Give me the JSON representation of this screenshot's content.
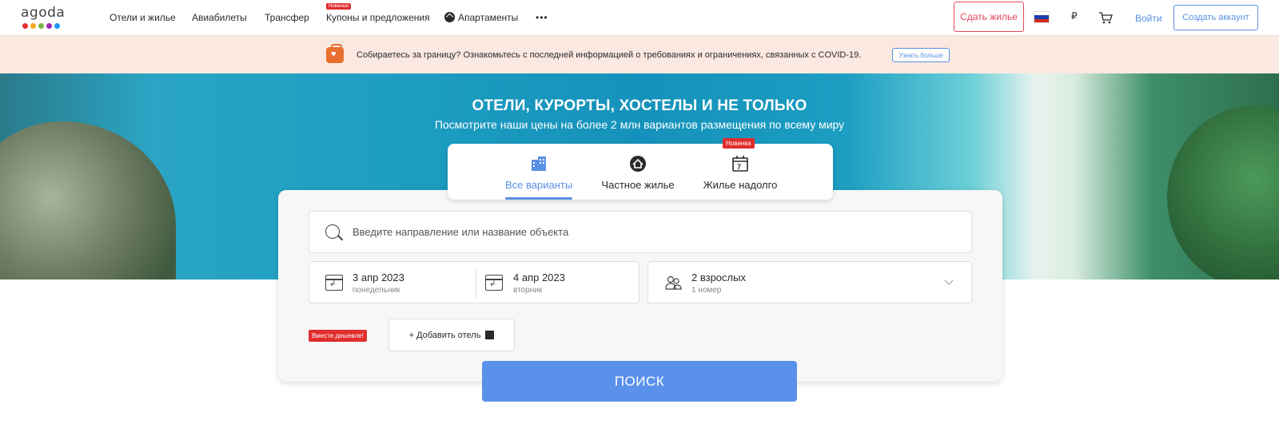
{
  "logo": {
    "text": "agoda",
    "dot_colors": [
      "#e12d2d",
      "#f5a623",
      "#7cb342",
      "#9c27b0",
      "#2196f3"
    ]
  },
  "nav": {
    "items": [
      "Отели и жилье",
      "Авиабилеты",
      "Трансфер",
      "Купоны и предложения",
      "Апартаменты",
      "•••"
    ],
    "coupons_badge": "Новинка!",
    "host_button": "Сдать жилье",
    "currency": "₽",
    "login": "Войти",
    "create_account": "Создать аккаунт"
  },
  "covid": {
    "text": "Собираетесь за границу? Ознакомьтесь с последней информацией о требованиях и ограничениях, связанных с COVID-19.",
    "button": "Узнать больше"
  },
  "hero": {
    "title": "ОТЕЛИ, КУРОРТЫ, ХОСТЕЛЫ И НЕ ТОЛЬКО",
    "subtitle": "Посмотрите наши цены на более 2 млн вариантов размещения по всему миру"
  },
  "tabs": {
    "items": [
      "Все варианты",
      "Частное жилье",
      "Жилье надолго"
    ],
    "active": "Все варианты",
    "new_badge": "Новинка"
  },
  "search": {
    "placeholder": "Введите направление или название объекта",
    "checkin": {
      "date": "3 апр 2023",
      "weekday": "понедельник"
    },
    "checkout": {
      "date": "4 апр 2023",
      "weekday": "вторник"
    },
    "guests": {
      "main": "2 взрослых",
      "sub": "1 номер"
    },
    "cheaper_badge": "Вместе дешевле!",
    "add_hotel": "+ Добавить отель",
    "button": "ПОИСК"
  },
  "colors": {
    "accent": "#5a8fe6",
    "brand_red": "#e12d2d",
    "host_pink": "#e4485c",
    "covid_bg": "#fbe8e0"
  }
}
